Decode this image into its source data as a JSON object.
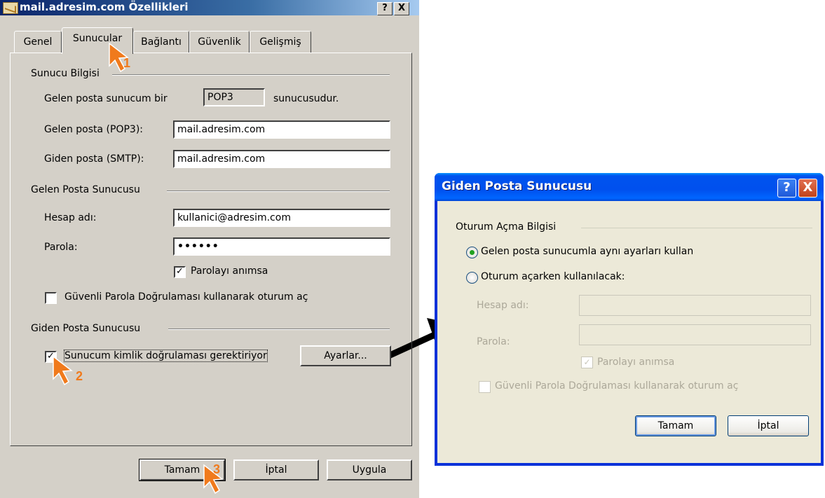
{
  "dialog1": {
    "title": "mail.adresim.com Özellikleri",
    "help_btn": "?",
    "close_btn": "X",
    "tabs": [
      "Genel",
      "Sunucular",
      "Bağlantı",
      "Güvenlik",
      "Gelişmiş"
    ],
    "active_tab": "Sunucular",
    "server_info": {
      "group_label": "Sunucu Bilgisi",
      "incoming_type_prefix": "Gelen posta sunucum bir",
      "incoming_type_value": "POP3",
      "incoming_type_suffix": "sunucusudur.",
      "pop3_label": "Gelen posta (POP3):",
      "pop3_value": "mail.adresim.com",
      "smtp_label": "Giden posta (SMTP):",
      "smtp_value": "mail.adresim.com"
    },
    "incoming_server": {
      "group_label": "Gelen Posta Sunucusu",
      "account_label": "Hesap adı:",
      "account_value": "kullanici@adresim.com",
      "password_label": "Parola:",
      "password_value": "••••••",
      "remember_label": "Parolayı anımsa",
      "remember_checked": true,
      "spa_label": "Güvenli Parola Doğrulaması kullanarak oturum aç",
      "spa_checked": false
    },
    "outgoing_server": {
      "group_label": "Giden Posta Sunucusu",
      "auth_label": "Sunucum kimlik doğrulaması gerektiriyor",
      "auth_checked": true,
      "settings_btn": "Ayarlar..."
    },
    "buttons": {
      "ok": "Tamam",
      "cancel": "İptal",
      "apply": "Uygula"
    }
  },
  "dialog2": {
    "title": "Giden Posta Sunucusu",
    "help_btn": "?",
    "close_btn": "X",
    "group_label": "Oturum Açma Bilgisi",
    "radio_same": "Gelen posta sunucumla aynı ayarları kullan",
    "radio_same_selected": true,
    "radio_custom": "Oturum açarken kullanılacak:",
    "account_label": "Hesap adı:",
    "password_label": "Parola:",
    "remember_label": "Parolayı anımsa",
    "spa_label": "Güvenli Parola Doğrulaması kullanarak oturum aç",
    "buttons": {
      "ok": "Tamam",
      "cancel": "İptal"
    }
  },
  "annotations": {
    "step1": "1",
    "step2": "2",
    "step3": "3"
  },
  "colors": {
    "annotation": "#f07a1c",
    "classic_face": "#d4d0c8",
    "xp_title": "#0053ee"
  }
}
